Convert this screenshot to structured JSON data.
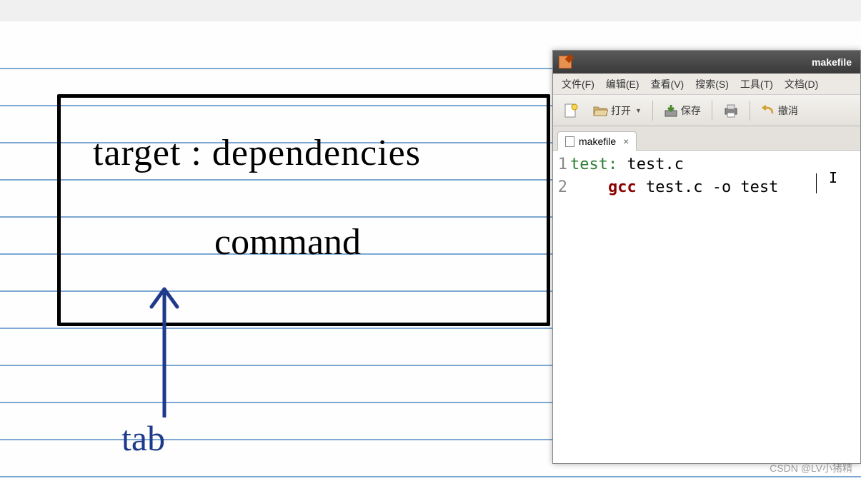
{
  "notebook": {
    "line1": "target : dependencies",
    "line2": "command",
    "arrow_label": "tab"
  },
  "editor": {
    "title": "makefile",
    "menus": {
      "file": "文件(F)",
      "edit": "编辑(E)",
      "view": "查看(V)",
      "search": "搜索(S)",
      "tools": "工具(T)",
      "documents": "文档(D)"
    },
    "toolbar": {
      "open": "打开",
      "save": "保存",
      "undo": "撤消"
    },
    "tab": {
      "name": "makefile"
    },
    "code": {
      "lines": [
        "1",
        "2"
      ],
      "line1_target": "test:",
      "line1_rest": " test.c",
      "line2_indent": "    ",
      "line2_cmd": "gcc",
      "line2_rest": " test.c -o test"
    }
  },
  "watermark": "CSDN @LV小猪精"
}
